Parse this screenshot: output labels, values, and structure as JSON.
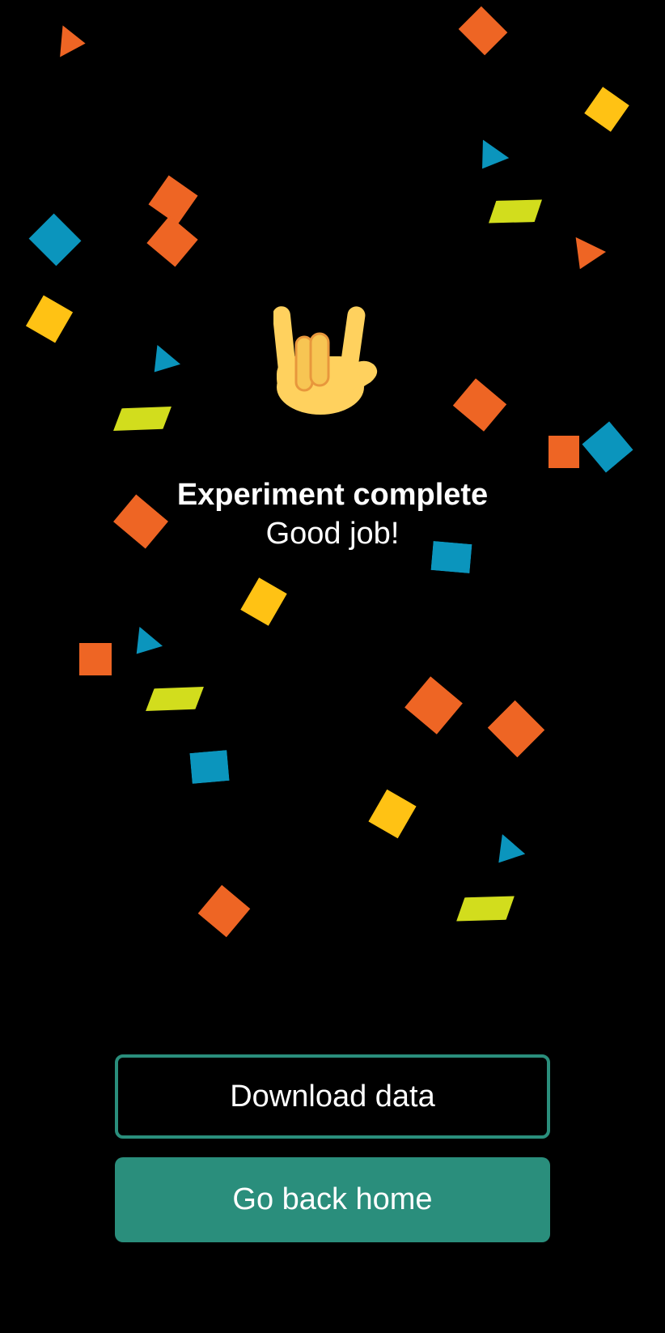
{
  "screen": {
    "icon": "sign-of-the-horns-hand-icon",
    "title": "Experiment complete",
    "subtitle": "Good job!"
  },
  "actions": {
    "download_label": "Download data",
    "home_label": "Go back home"
  },
  "colors": {
    "background": "#000000",
    "accent": "#2a8e7c",
    "text": "#ffffff",
    "confetti": [
      "#ee6524",
      "#0b95bd",
      "#ffc214",
      "#d2dd1d"
    ]
  }
}
